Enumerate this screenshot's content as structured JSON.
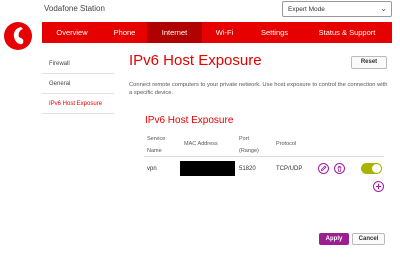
{
  "header": {
    "title": "Vodafone Station",
    "mode_select": {
      "value": "Expert Mode"
    },
    "brand_color": "#e60000"
  },
  "nav": {
    "items": [
      {
        "label": "Overview"
      },
      {
        "label": "Phone"
      },
      {
        "label": "Internet",
        "active": true
      },
      {
        "label": "Wi-Fi"
      },
      {
        "label": "Settings"
      },
      {
        "label": "Status & Support"
      }
    ]
  },
  "sidebar": {
    "items": [
      {
        "label": "Firewall"
      },
      {
        "label": "General"
      },
      {
        "label": "IPv6 Host Exposure",
        "active": true
      }
    ]
  },
  "main": {
    "title": "IPv6 Host Exposure",
    "reset_label": "Reset",
    "description": "Connect remote computers to your private network. Use host exposure to control the connection with a specific device.",
    "section_title": "IPv6 Host Exposure",
    "table": {
      "headers": {
        "service_name_1": "Service",
        "service_name_2": "Name",
        "mac": "MAC Address",
        "port_1": "Port",
        "port_2": "(Range)",
        "protocol": "Protocol"
      },
      "rows": [
        {
          "service": "vpn",
          "port": "51820",
          "protocol": "TCP/UDP",
          "enabled": true
        }
      ]
    },
    "apply_label": "Apply",
    "cancel_label": "Cancel",
    "accent_color": "#9c1f8f",
    "toggle_color": "#a8b400"
  }
}
